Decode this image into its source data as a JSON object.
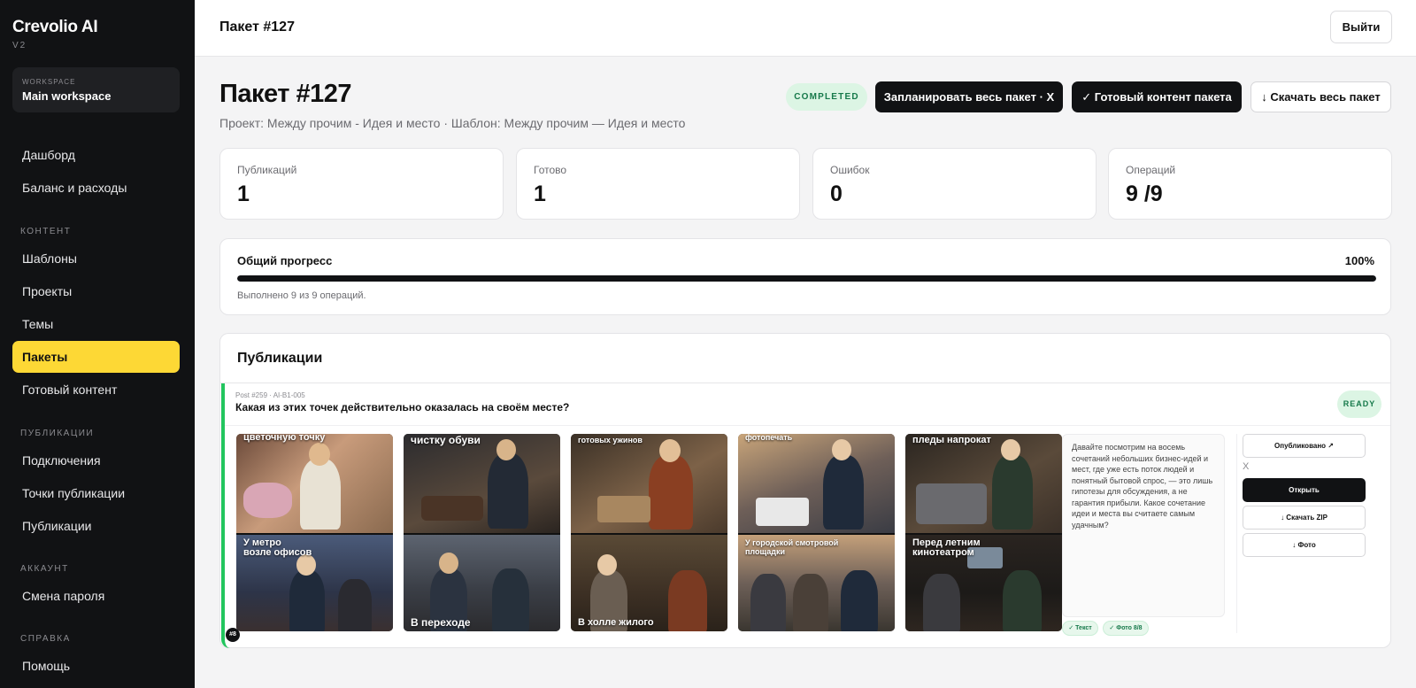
{
  "sidebar": {
    "brand": "Crevolio AI",
    "version": "V2",
    "workspace_label": "WORKSPACE",
    "workspace_name": "Main workspace",
    "items": {
      "dashboard": "Дашборд",
      "balance": "Баланс и расходы",
      "templates": "Шаблоны",
      "projects": "Проекты",
      "themes": "Темы",
      "packages": "Пакеты",
      "ready_content": "Готовый контент",
      "connections": "Подключения",
      "publish_points": "Точки публикации",
      "publications": "Публикации",
      "change_password": "Смена пароля",
      "help": "Помощь"
    },
    "sections": {
      "content": "КОНТЕНТ",
      "publications": "ПУБЛИКАЦИИ",
      "account": "АККАУНТ",
      "help": "СПРАВКА"
    }
  },
  "topbar": {
    "title": "Пакет #127",
    "logout": "Выйти"
  },
  "header": {
    "title": "Пакет #127",
    "subtitle": "Проект: Между прочим - Идея и место · Шаблон: Между прочим — Идея и место",
    "status": "COMPLETED",
    "schedule_button": "Запланировать весь пакет · X",
    "ready_button": "✓ Готовый контент пакета",
    "download_button": "↓ Скачать весь пакет"
  },
  "stats": {
    "publications": {
      "label": "Публикаций",
      "value": "1"
    },
    "ready": {
      "label": "Готово",
      "value": "1"
    },
    "errors": {
      "label": "Ошибок",
      "value": "0"
    },
    "operations": {
      "label": "Операций",
      "value": "9 /9"
    }
  },
  "progress": {
    "title": "Общий прогресс",
    "percent_label": "100%",
    "percent": 100,
    "note": "Выполнено 9 из 9 операций."
  },
  "publications": {
    "title": "Публикации",
    "post": {
      "meta": "Post #259 · AI-B1-005",
      "title": "Какая из этих точек действительно оказалась на своём месте?",
      "status": "READY",
      "number": "#8",
      "images": [
        {
          "top": "цветочную точку",
          "bottom": "У метро\nвозле офисов"
        },
        {
          "top": "чистку обуви",
          "bottom": "В переходе"
        },
        {
          "top": "готовых ужинов",
          "bottom": "В холле жилого"
        },
        {
          "top": "фотопечать",
          "bottom": "У городской смотровой\nплощадки"
        },
        {
          "top": "пледы напрокат",
          "bottom": "Перед летним\nкинотеатром"
        }
      ],
      "text": "Давайте посмотрим на восемь сочетаний небольших бизнес-идей и мест, где уже есть поток людей и понятный бытовой спрос, — это лишь гипотезы для обсуждения, а не гарантия прибыли. Какое сочетание идеи и места вы считаете самым удачным?",
      "chip_text": "✓ Текст",
      "chip_photo": "✓ Фото 8/8",
      "actions": {
        "published": "Опубликовано ↗",
        "x": "X",
        "open": "Открыть",
        "zip": "↓ Скачать ZIP",
        "photo": "↓ Фото"
      }
    }
  }
}
